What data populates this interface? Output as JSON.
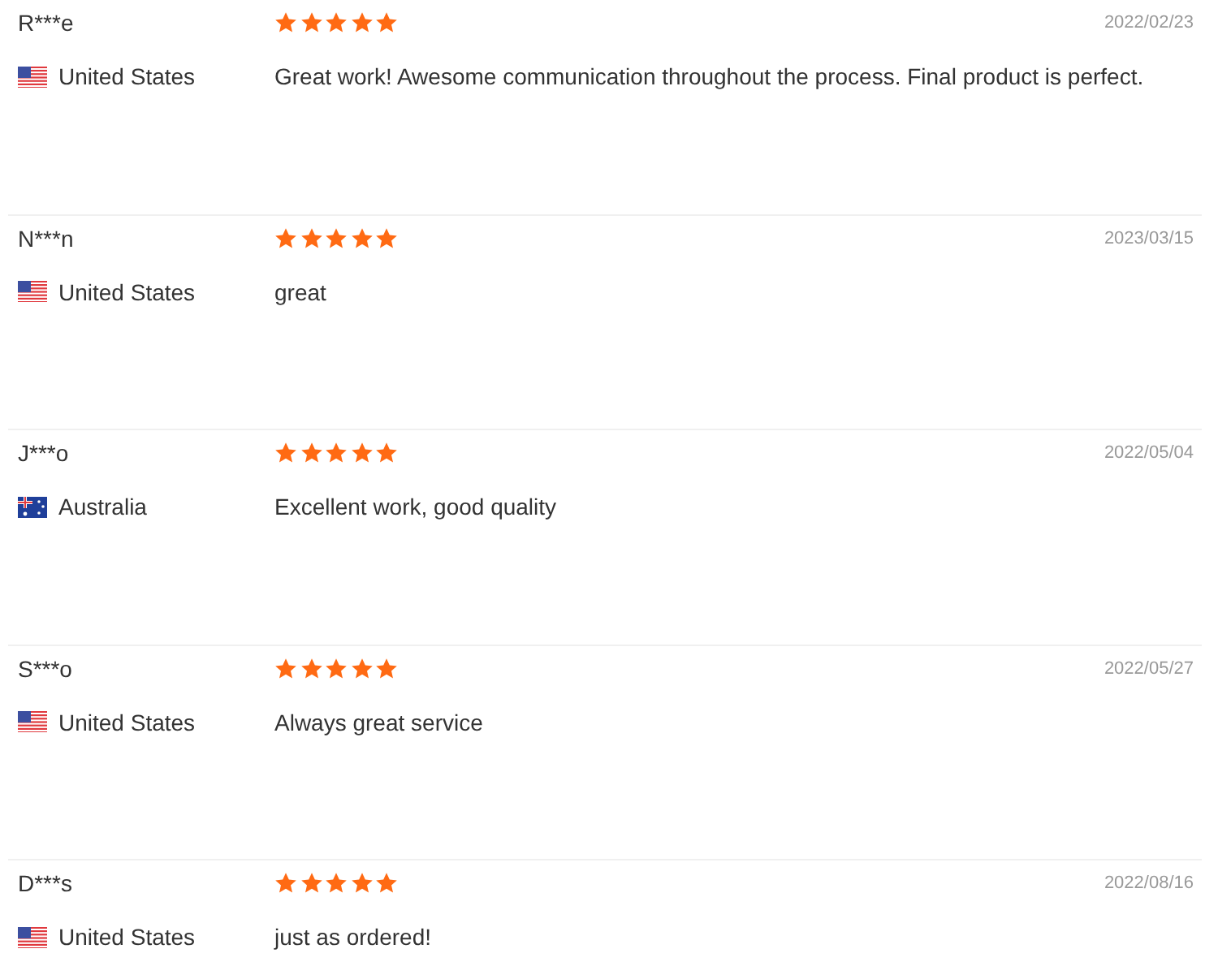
{
  "reviews": [
    {
      "name": "R***e",
      "stars": 5,
      "date": "2022/02/23",
      "country": {
        "kind": "us",
        "label": "United States"
      },
      "comment": "Great work! Awesome communication throughout the process. Final product is perfect."
    },
    {
      "name": "N***n",
      "stars": 5,
      "date": "2023/03/15",
      "country": {
        "kind": "us",
        "label": "United States"
      },
      "comment": "great"
    },
    {
      "name": "J***o",
      "stars": 5,
      "date": "2022/05/04",
      "country": {
        "kind": "au",
        "label": "Australia"
      },
      "comment": "Excellent work, good quality"
    },
    {
      "name": "S***o",
      "stars": 5,
      "date": "2022/05/27",
      "country": {
        "kind": "us",
        "label": "United States"
      },
      "comment": "Always great service"
    },
    {
      "name": "D***s",
      "stars": 5,
      "date": "2022/08/16",
      "country": {
        "kind": "us",
        "label": "United States"
      },
      "comment": "just as ordered!"
    }
  ]
}
